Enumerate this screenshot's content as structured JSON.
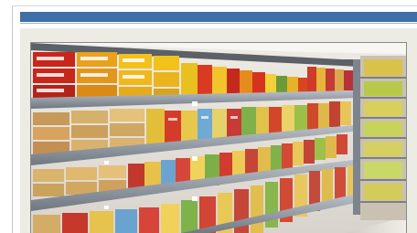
{
  "header": {
    "accent_color": "#3f6fa7"
  },
  "photo": {
    "subject": "supermarket-snack-aisle",
    "brand_colors": {
      "red": "#c8261b",
      "yellow": "#f2c21a",
      "shelf": "#9aa3ad",
      "wall": "#e8e5df"
    }
  }
}
